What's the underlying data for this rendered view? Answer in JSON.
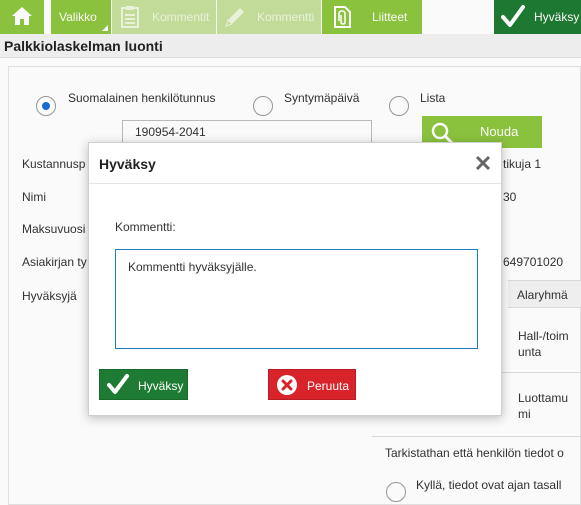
{
  "toolbar": {
    "valikko_label": "Valikko",
    "kommentit_label": "Kommentit",
    "kommentti_label": "Kommentti",
    "liitteet_label": "Liitteet",
    "hyvaksy_label": "Hyväksy"
  },
  "page": {
    "title": "Palkkiolaskelman luonti"
  },
  "form": {
    "radio_hetu": "Suomalainen henkilötunnus",
    "radio_syntymapaiva": "Syntymäpäivä",
    "radio_lista": "Lista",
    "hetu_value": "190954-2041",
    "nouda_label": "Nouda",
    "kustannuspaikka_label": "Kustannusp",
    "kustannuspaikka_value": "tikuja 1",
    "nimi_label": "Nimi",
    "nimi_value": "30",
    "maksuvuosi_label": "Maksuvuosi",
    "asiakirja_label": "Asiakirjan ty",
    "asiakirja_value": "649701020",
    "hyvaksyja_label": "Hyväksyjä",
    "col_alaryhma": "Alaryhmä",
    "row1_value": "Hall-/toim\nunta",
    "row2_value": "Luottamu\nmi",
    "check_question": "Tarkistathan että henkilön tiedot o",
    "check_yes": "Kyllä, tiedot ovat ajan tasall"
  },
  "modal": {
    "title": "Hyväksy",
    "comment_label": "Kommentti:",
    "comment_value": "Kommentti hyväksyjälle.",
    "ok_label": "Hyväksy",
    "cancel_label": "Peruuta"
  },
  "colors": {
    "toolbar_green": "#8ec63f",
    "toolbar_green_disabled": "#c6e09c",
    "approve_green": "#1e7b34",
    "cancel_red": "#d8232a",
    "radio_selected": "#1a6fd1",
    "textarea_border": "#1a7fc4"
  },
  "icons": {
    "home": "home-icon",
    "kommentit": "notes-icon",
    "kommentti": "pencil-icon",
    "liitteet": "attachment-icon",
    "hyvaksy": "checkmark-icon",
    "nouda": "search-icon",
    "close": "close-icon",
    "cancel": "x-circle-icon"
  }
}
